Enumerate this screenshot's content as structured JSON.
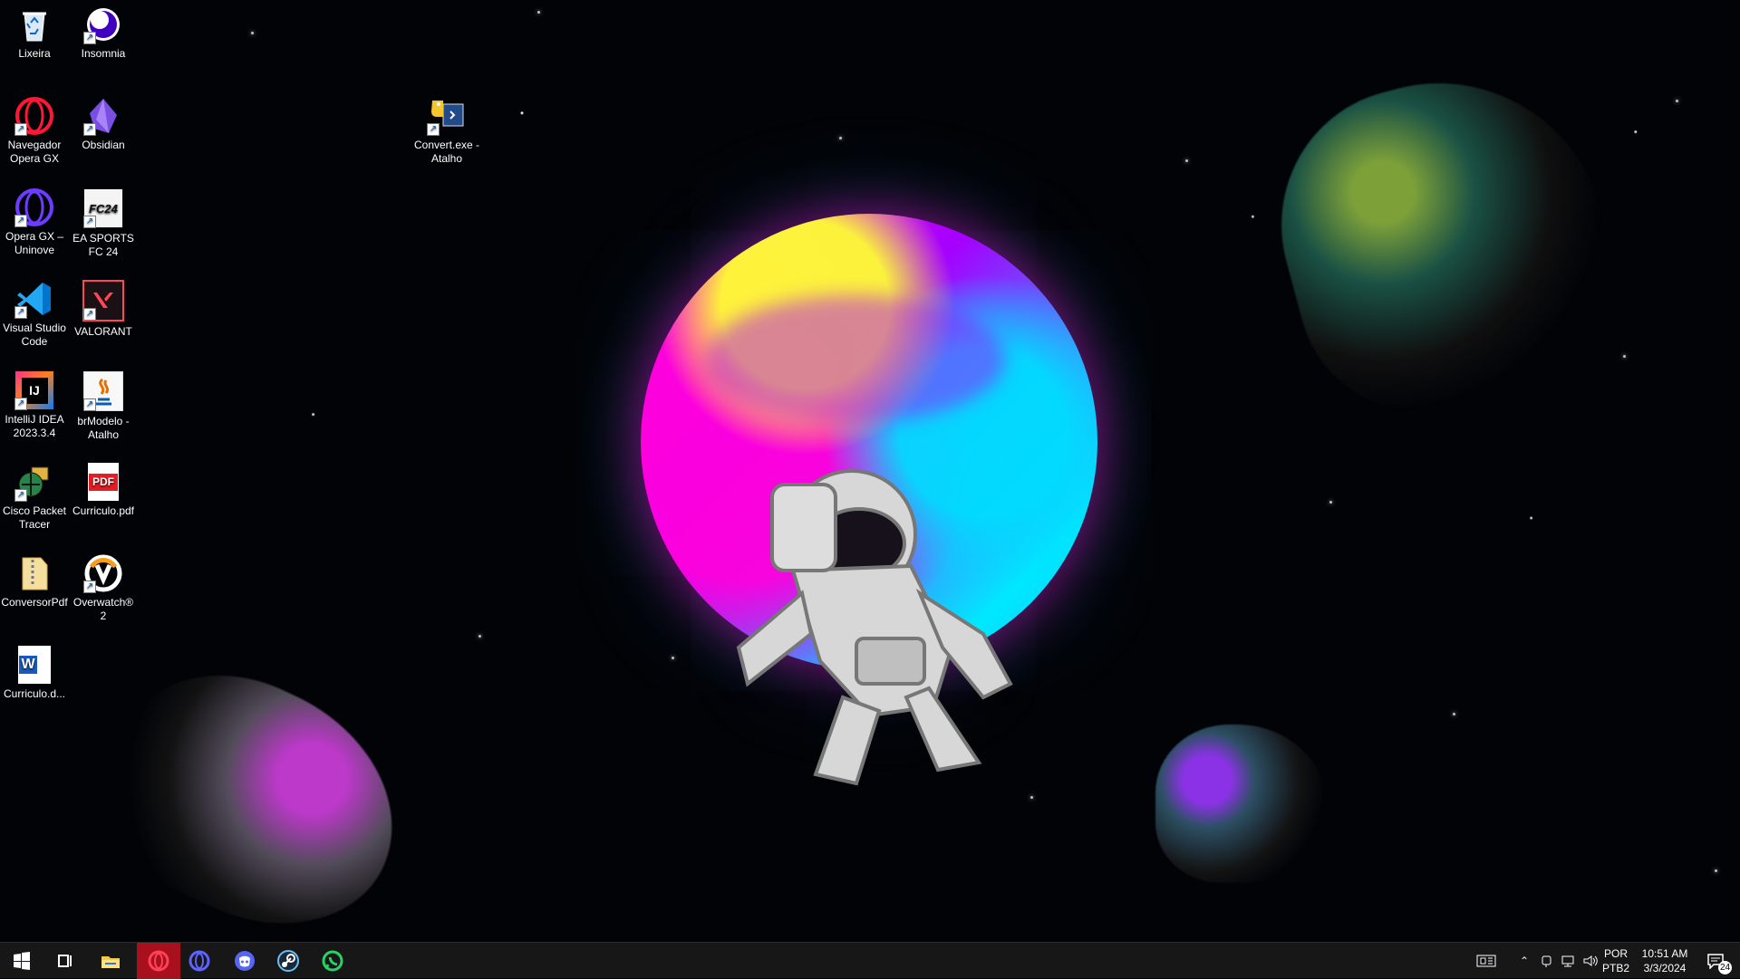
{
  "desktop": {
    "icons": [
      {
        "label": "Lixeira",
        "icon": "recycle-bin-icon"
      },
      {
        "label": "Insomnia",
        "icon": "insomnia-icon"
      },
      {
        "label": "Navegador\nOpera GX",
        "icon": "opera-gx-icon"
      },
      {
        "label": "Obsidian",
        "icon": "obsidian-icon"
      },
      {
        "label": "Opera GX –\nUninove",
        "icon": "opera-gx-icon"
      },
      {
        "label": "EA SPORTS\nFC 24",
        "icon": "ea-sports-fc-icon"
      },
      {
        "label": "Visual Studio\nCode",
        "icon": "visual-studio-code-icon"
      },
      {
        "label": "VALORANT",
        "icon": "valorant-icon"
      },
      {
        "label": "IntelliJ IDEA\n2023.3.4",
        "icon": "intellij-idea-icon"
      },
      {
        "label": "brModelo -\nAtalho",
        "icon": "java-brmodelo-icon"
      },
      {
        "label": "Cisco Packet\nTracer",
        "icon": "cisco-packet-tracer-icon"
      },
      {
        "label": "Curriculo.pdf",
        "icon": "pdf-file-icon"
      },
      {
        "label": "ConversorPdf",
        "icon": "folder-zip-icon"
      },
      {
        "label": "Overwatch®\n2",
        "icon": "overwatch-icon"
      },
      {
        "label": "Curriculo.d...",
        "icon": "word-document-icon"
      },
      {
        "label": "Convert.exe -\nAtalho",
        "icon": "python-shortcut-icon"
      }
    ],
    "icon_text": {
      "ea_badge": "FC24",
      "intellij_badge": "IJ",
      "pdf_badge": "PDF",
      "word_badge": "W"
    }
  },
  "taskbar": {
    "apps": [
      {
        "name": "windows-start",
        "icon": "windows-start-icon"
      },
      {
        "name": "task-view",
        "icon": "task-view-icon"
      },
      {
        "name": "file-explorer",
        "icon": "file-explorer-icon"
      },
      {
        "name": "opera-gx",
        "icon": "opera-gx-icon",
        "active": true
      },
      {
        "name": "opera-browser",
        "icon": "opera-browser-icon"
      },
      {
        "name": "discord",
        "icon": "discord-icon"
      },
      {
        "name": "steam",
        "icon": "steam-icon"
      },
      {
        "name": "whatsapp",
        "icon": "whatsapp-icon"
      }
    ],
    "tray": {
      "language_top": "POR",
      "language_bottom": "PTB2",
      "time": "10:51 AM",
      "date": "3/3/2024",
      "notification_count": "24"
    }
  }
}
